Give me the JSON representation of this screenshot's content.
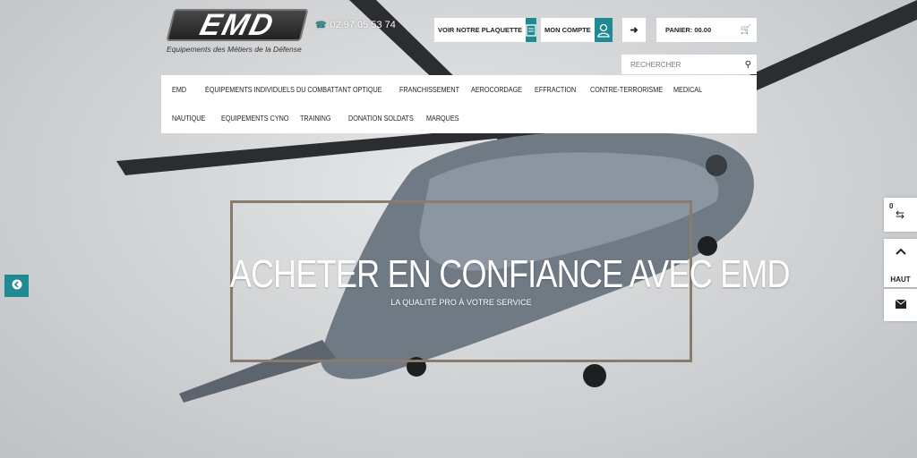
{
  "header": {
    "logo_text": "EMD",
    "logo_tagline": "Equipements des Métiers de la Défense",
    "phone": "02 97 05 53 74",
    "plaquette_label": "VOIR NOTRE PLAQUETTE",
    "compte_label": "MON COMPTE",
    "panier_label": "PANIER: 00.00",
    "search_placeholder": "RECHERCHER"
  },
  "nav": {
    "items": [
      "EMD",
      "ÉQUIPEMENTS INDIVIDUELS DU COMBATTANT",
      "OPTIQUE",
      "FRANCHISSEMENT",
      "AEROCORDAGE",
      "EFFRACTION",
      "CONTRE-TERRORISME",
      "MEDICAL",
      "NAUTIQUE",
      "EQUIPEMENTS CYNO",
      "TRAINING",
      "DONATION SOLDATS",
      "MARQUES"
    ]
  },
  "hero": {
    "title": "ACHETER EN CONFIANCE AVEC EMD",
    "subtitle": "LA QUALITÉ PRO À VOTRE SERVICE"
  },
  "side": {
    "compare_count": "0",
    "top_label": "HAUT"
  },
  "icons": {
    "phone": "phone-icon",
    "document": "document-icon",
    "user": "user-icon",
    "login": "sign-in-icon",
    "cart": "cart-icon",
    "search": "search-icon",
    "arrow_left": "circle-arrow-left-icon",
    "compare": "retweet-icon",
    "chevron_up": "chevron-up-icon",
    "mail": "envelope-icon"
  },
  "colors": {
    "accent": "#1f8a92",
    "frame": "#8a7c6c"
  }
}
